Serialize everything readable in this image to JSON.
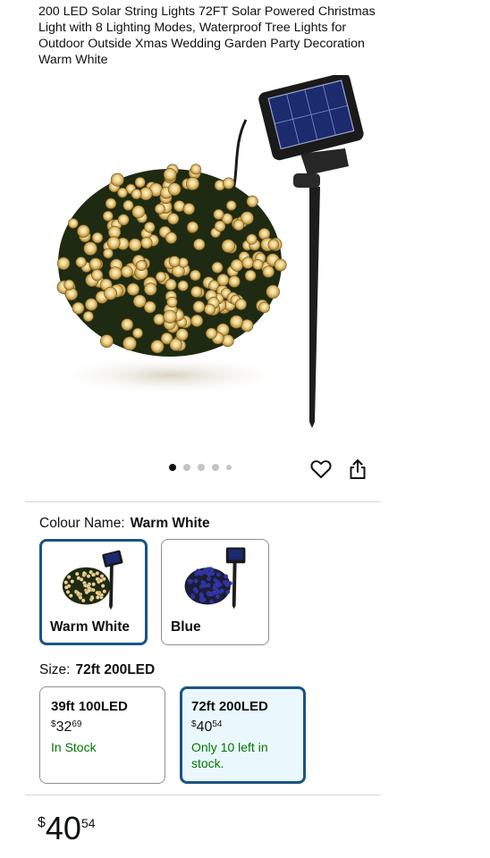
{
  "product": {
    "title": "200 LED Solar String Lights 72FT Solar Powered Christmas Light with 8 Lighting Modes, Waterproof Tree Lights for Outdoor Outside Xmas Wedding Garden Party Decoration Warm White",
    "image_page_count": 5,
    "image_current_index": 0
  },
  "colour": {
    "label": "Colour Name:",
    "selected": "Warm White",
    "options": [
      {
        "label": "Warm White",
        "led_color": "#f1d38a",
        "selected": true
      },
      {
        "label": "Blue",
        "led_color": "#2a2fb8",
        "selected": false
      }
    ]
  },
  "size": {
    "label": "Size:",
    "selected": "72ft 200LED",
    "options": [
      {
        "name": "39ft 100LED",
        "currency": "$",
        "whole": "32",
        "cents": "69",
        "availability": "In Stock",
        "selected": false
      },
      {
        "name": "72ft 200LED",
        "currency": "$",
        "whole": "40",
        "cents": "54",
        "availability": "Only 10 left in stock.",
        "selected": true
      }
    ]
  },
  "price": {
    "currency": "$",
    "whole": "40",
    "cents": "54"
  },
  "colors": {
    "accent_border": "#1a5487",
    "selected_bg": "#eaf8fd",
    "stock_green": "#007600"
  },
  "icons": {
    "wishlist": "heart-icon",
    "share": "share-icon"
  }
}
